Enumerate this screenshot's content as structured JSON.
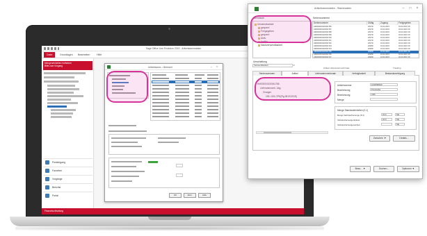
{
  "laptop_app": {
    "title": "Sage Office Line Evolution 2015 - Artikelstammdaten",
    "ribbon_tabs": [
      "Datei",
      "Grundlagen",
      "Bearbeiten",
      "Hilfe"
    ],
    "banner_lines": [
      "Mengeneinheiten fortfahren",
      "Bitte zum Vorgang"
    ],
    "nav_items": [
      "Posteingang",
      "Favoriten",
      "Vorgänge",
      "Berichte",
      "Portal"
    ],
    "status_text": "Finanzbuchhaltung",
    "dialog_title": "Artikelstamm - Übersicht",
    "dialog_buttons": [
      "OK",
      "Abbr.",
      "Hilfe"
    ]
  },
  "overlay": {
    "title": "Artikelstammdaten - Stammdaten",
    "controls": [
      "–",
      "□",
      "×"
    ],
    "left_label": "Suchbaum",
    "grid_label": "Seriennummern",
    "tree_nodes": [
      "Verwendbarkeit",
      "gesperrt",
      "Freigegeben",
      "gesperrt",
      "Aktiv",
      "Inaktiv",
      "Nachverwendbarkeit"
    ],
    "grid_headers": [
      "Seriennummer",
      "Gültig",
      "Zugang",
      "Freigegeben"
    ],
    "grid_rows": [
      [
        "HM000000220061786",
        "2047R",
        "01.04.2015",
        "02.03.2015 18"
      ],
      [
        "HM000000220061787",
        "2047R",
        "01.04.2015",
        "02.03.2015 18"
      ],
      [
        "HM000000220061788",
        "2047R",
        "01.04.2015",
        "02.03.2015 18"
      ],
      [
        "HM000000220061789",
        "2047R",
        "01.04.2015",
        "02.03.2015 18"
      ],
      [
        "HM000000220061790",
        "2047R",
        "01.04.2015",
        "02.03.2015 18"
      ],
      [
        "HM000000220061791",
        "2047R",
        "01.04.2015",
        "02.03.2015 18"
      ],
      [
        "HM000000220061792",
        "2047R",
        "01.04.2015",
        "02.03.2015 18"
      ],
      [
        "HM000000220061793",
        "2048R",
        "01.04.2015",
        "02.03.2015 18"
      ],
      [
        "HM000000220061794",
        "2048R",
        "01.04.2015",
        "02.03.2015 18"
      ],
      [
        "HM000000220061795",
        "2048R",
        "01.04.2015",
        "02.03.2015 18"
      ],
      [
        "HM000000220061796",
        "2048R",
        "01.04.2015",
        "02.03.2015 18"
      ],
      [
        "HM000000220061797",
        "2048R",
        "01.04.2015",
        "02.03.2015 18"
      ]
    ],
    "selected_row": 9,
    "filter_label": "Umschaltung",
    "filter_value": "Verwendbarkeit",
    "sub_group": "Artikel Lieferantenmerkmale",
    "sub_group_right": "Tracking",
    "tabs": [
      "Seriennummern",
      "Artikel",
      "Lieferantenmerkmale",
      "Verfolgbarkeit",
      "Bestandsverfolgung"
    ],
    "active_tab": 1,
    "tree_text": [
      "HM000000220061786",
      "Lieferantenverb. Abg.",
      "Chargen",
      "193 • 001 CP6 [Fig.28.03.2015]"
    ],
    "right_box_title": "Artikelnummer",
    "right_box_value": "1234568910",
    "right_rows": [
      {
        "label": "Bezeichnung",
        "value": "Prozessbe"
      },
      {
        "label": "Bezeichnung",
        "value": "CD6"
      },
      {
        "label": "Menge",
        "value": ""
      }
    ],
    "unit_title": "Menge Standardeinheiten (0.1)",
    "unit_rows": [
      {
        "label": "Menge Verbrauchsmenge (D,1)",
        "value": "24,0",
        "unit": "Stk"
      },
      {
        "label": "Verbrauchsmenge Einheit",
        "value": "24,0",
        "unit": "Stk"
      },
      {
        "label": "Verbrauchsmengeneinheit",
        "value": "",
        "unit": "Stk"
      }
    ],
    "panel_buttons": [
      "Zwischen ▼",
      "Details..."
    ],
    "bottom_buttons": [
      "Beso... ▼",
      "Suchen...",
      "Optionen ▼"
    ]
  },
  "colors": {
    "brand_red": "#c8102e",
    "highlight_pink": "#d6339a",
    "selection_blue": "#2a6fb8",
    "logo_green": "#2e7d32"
  }
}
